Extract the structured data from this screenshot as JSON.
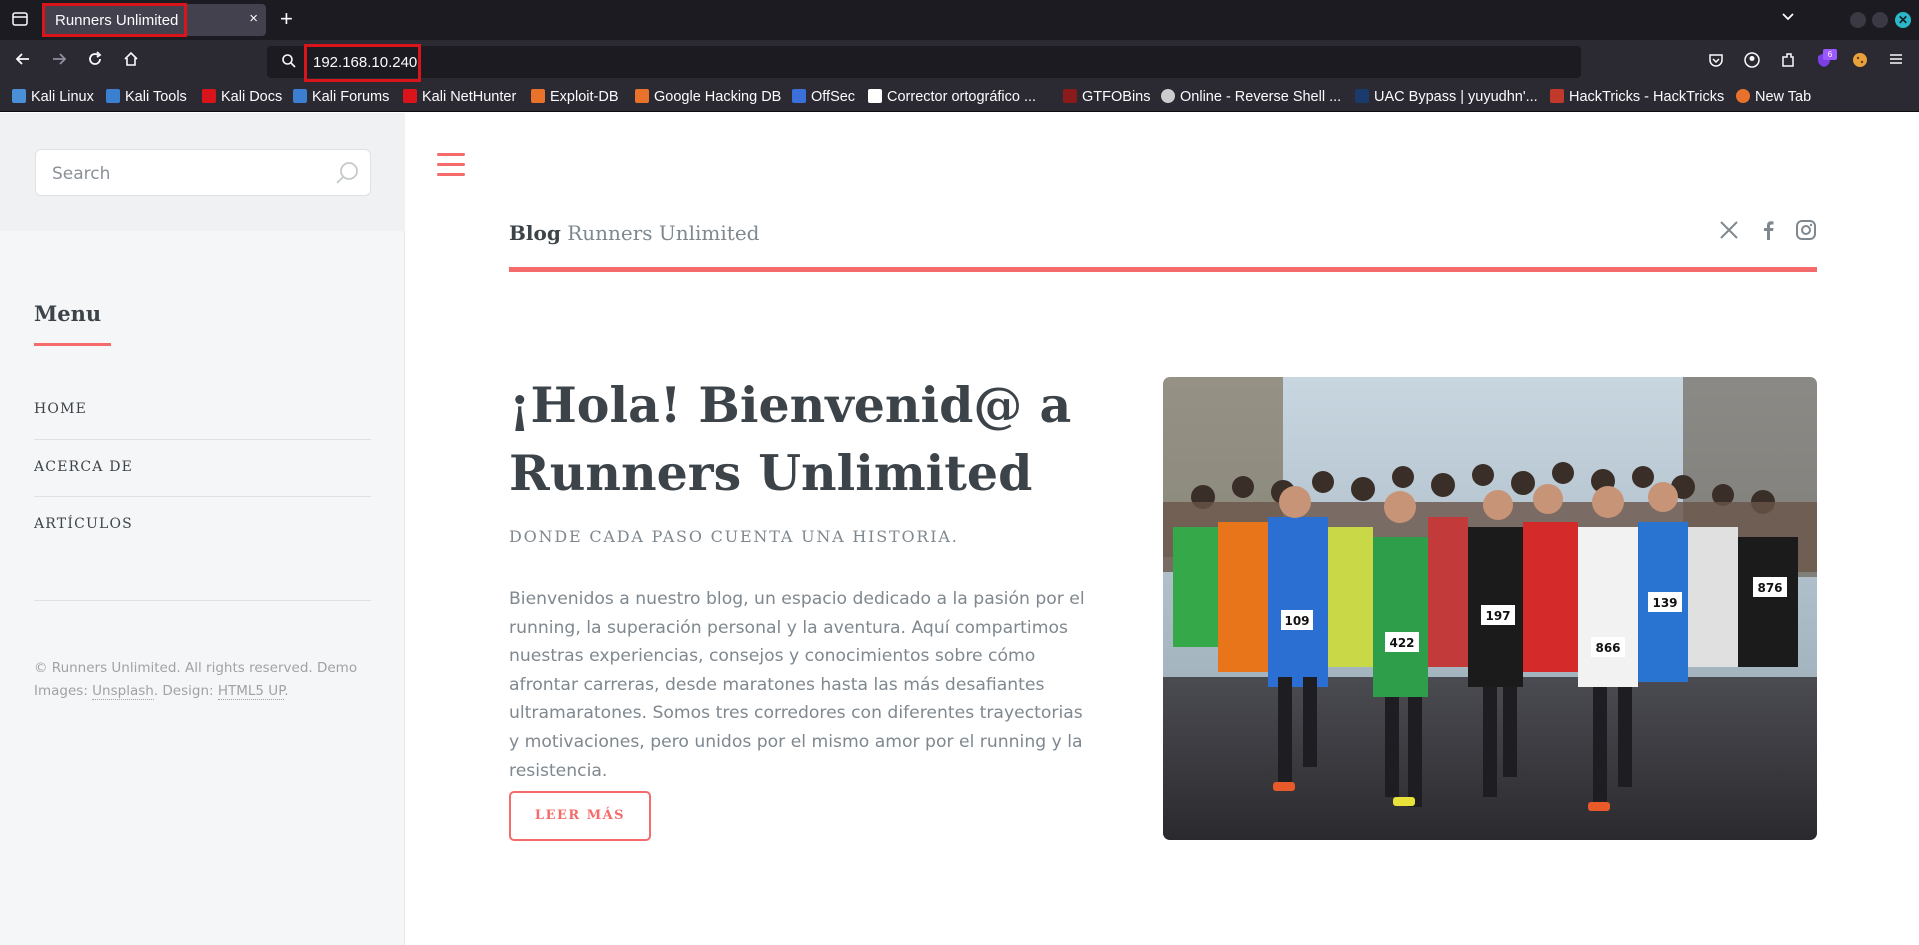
{
  "browser": {
    "tab_title": "Runners Unlimited",
    "tab_close": "×",
    "new_tab": "+",
    "url": "192.168.10.240",
    "extension_badge": "6",
    "bookmarks": [
      {
        "label": "Kali Linux",
        "color": "#4a90d9"
      },
      {
        "label": "Kali Tools",
        "color": "#3b7fd1"
      },
      {
        "label": "Kali Docs",
        "color": "#d9141b"
      },
      {
        "label": "Kali Forums",
        "color": "#3b7fd1"
      },
      {
        "label": "Kali NetHunter",
        "color": "#d9141b"
      },
      {
        "label": "Exploit-DB",
        "color": "#e8722c"
      },
      {
        "label": "Google Hacking DB",
        "color": "#e8722c"
      },
      {
        "label": "OffSec",
        "color": "#3b6fd9"
      },
      {
        "label": "Corrector ortográfico ...",
        "color": "#ffffff"
      },
      {
        "label": "GTFOBins",
        "color": "#8b1a1a"
      },
      {
        "label": "Online - Reverse Shell ...",
        "color": "#cccccc"
      },
      {
        "label": "UAC Bypass | yuyudhn'...",
        "color": "#1a3a6b"
      },
      {
        "label": "HackTricks - HackTricks",
        "color": "#c0392b"
      },
      {
        "label": "New Tab",
        "color": "#e8722c"
      }
    ]
  },
  "sidebar": {
    "search_placeholder": "Search",
    "menu_title": "Menu",
    "items": [
      {
        "label": "HOME"
      },
      {
        "label": "ACERCA DE"
      },
      {
        "label": "ARTÍCULOS"
      }
    ],
    "footer": {
      "copyright": "© Runners Unlimited. All rights reserved. Demo Images: ",
      "unsplash": "Unsplash",
      "design_sep": ". Design: ",
      "html5up": "HTML5 UP",
      "end": "."
    }
  },
  "header": {
    "blog_label": "Blog",
    "site_name": "Runners Unlimited",
    "social": [
      "x-icon",
      "facebook-icon",
      "instagram-icon"
    ]
  },
  "hero": {
    "title": "¡Hola! Bienvenid@ a Runners Unlimited",
    "subtitle": "DONDE CADA PASO CUENTA UNA HISTORIA.",
    "body": "Bienvenidos a nuestro blog, un espacio dedicado a la pasión por el running, la superación personal y la aventura. Aquí compartimos nuestras experiencias, consejos y conocimientos sobre cómo afrontar carreras, desde maratones hasta las más desafiantes ultramaratones. Somos tres corredores con diferentes trayectorias y motivaciones, pero unidos por el mismo amor por el running y la resistencia.",
    "button": "LEER MÁS",
    "bibs": [
      "109",
      "422",
      "197",
      "866",
      "139",
      "876"
    ]
  },
  "colors": {
    "accent": "#f56a6a",
    "text": "#3d4449",
    "muted": "#7f888f",
    "highlight": "#d9141b"
  }
}
